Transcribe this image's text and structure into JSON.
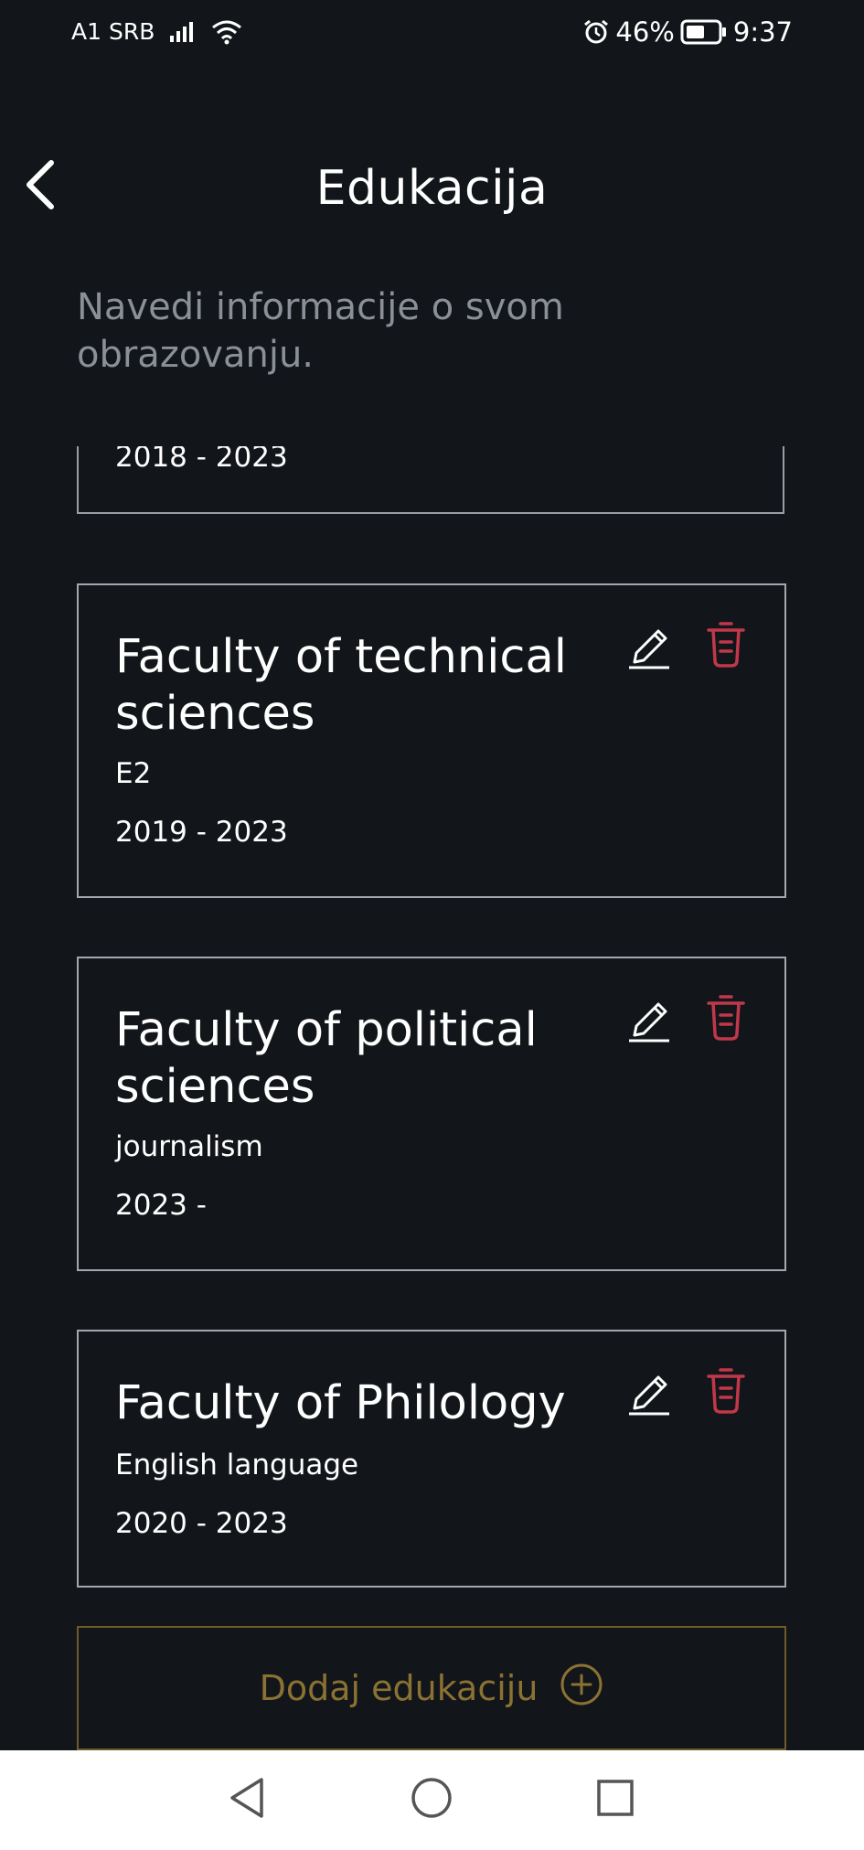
{
  "status_bar": {
    "carrier": "A1 SRB",
    "battery_percent": "46%",
    "time": "9:37",
    "icons": [
      "signal-icon",
      "wifi-icon",
      "alarm-icon",
      "battery-icon"
    ]
  },
  "header": {
    "title": "Edukacija",
    "back_icon": "chevron-left-icon"
  },
  "subtitle": "Navedi informacije o svom obrazovanju.",
  "partial_entry": {
    "years": "2018 - 2023"
  },
  "education": [
    {
      "name": "Faculty of technical sciences",
      "field": "E2",
      "years": "2019 - 2023"
    },
    {
      "name": "Faculty of political sciences",
      "field": "journalism",
      "years": "2023 -"
    },
    {
      "name": "Faculty of Philology",
      "field": "English language",
      "years": "2020 - 2023"
    }
  ],
  "add_button": {
    "label": "Dodaj edukaciju",
    "icon": "plus-circle-icon"
  },
  "colors": {
    "background": "#121519",
    "text": "#ffffff",
    "subtitle": "#8b8f98",
    "card_border": "#a4a7ad",
    "delete": "#c0384a",
    "add_accent": "#8a7233"
  },
  "nav_bar": {
    "icons": [
      "back-triangle-icon",
      "home-circle-icon",
      "recents-square-icon"
    ]
  }
}
